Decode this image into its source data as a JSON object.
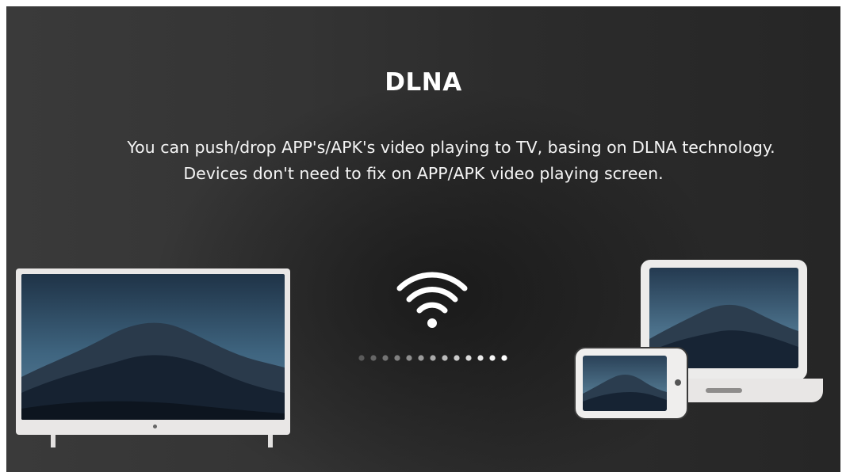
{
  "screen": {
    "title": "DLNA",
    "description_line1": "You can push/drop APP's/APK's video playing to TV, basing on DLNA technology.",
    "description_line2": "Devices don't need to fix on APP/APK video playing screen."
  },
  "icons": {
    "tv": "tv-icon",
    "wifi": "wifi-icon",
    "laptop": "laptop-icon",
    "phone": "phone-icon",
    "wallpaper": "mountain-wallpaper"
  },
  "colors": {
    "background": "#303030",
    "text": "#ffffff",
    "device_frame": "#e9e7e6",
    "wallpaper_sky": "#2d4a63",
    "wallpaper_mountain": "#141e2a"
  }
}
